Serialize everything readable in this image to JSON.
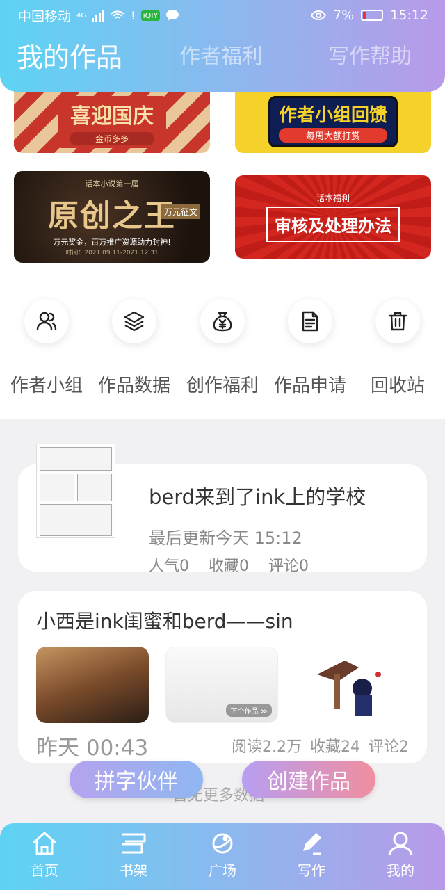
{
  "status_bar": {
    "carrier": "中国移动",
    "network": "4G",
    "battery": "7%",
    "time": "15:12"
  },
  "header": {
    "tabs": [
      {
        "label": "我的作品",
        "active": true
      },
      {
        "label": "作者福利",
        "active": false
      },
      {
        "label": "写作帮助",
        "active": false
      }
    ]
  },
  "banners": [
    {
      "title": "喜迎国庆",
      "subtitle": "金币多多"
    },
    {
      "title": "作者小组回馈",
      "subtitle": "每周大额打赏"
    },
    {
      "top": "话本小说第一届",
      "title": "原创之王",
      "tag": "万元征文",
      "subtitle": "万元奖金，百万推广资源助力封神!",
      "time": "时间：2021.09.11-2021.12.31"
    },
    {
      "top": "话本福利",
      "title": "审核及处理办法"
    }
  ],
  "shortcuts": [
    {
      "label": "作者小组",
      "icon": "users-icon"
    },
    {
      "label": "作品数据",
      "icon": "layers-icon"
    },
    {
      "label": "创作福利",
      "icon": "money-bag-icon"
    },
    {
      "label": "作品申请",
      "icon": "document-icon"
    },
    {
      "label": "回收站",
      "icon": "trash-icon"
    }
  ],
  "works": [
    {
      "title": "berd来到了ink上的学校",
      "updated": "最后更新今天 15:12",
      "popularity": "人气0",
      "favorites": "收藏0",
      "comments": "评论0"
    },
    {
      "title": "小西是ink闺蜜和berd——sin",
      "time": "昨天 00:43",
      "reads": "阅读2.2万",
      "favorites": "收藏24",
      "comments": "评论2",
      "next_label": "下个作品 ≫"
    }
  ],
  "more_text": "暂无更多数据",
  "float_buttons": {
    "partner": "拼字伙伴",
    "create": "创建作品"
  },
  "bottom_nav": [
    {
      "label": "首页",
      "icon": "home-icon"
    },
    {
      "label": "书架",
      "icon": "bookshelf-icon"
    },
    {
      "label": "广场",
      "icon": "planet-icon"
    },
    {
      "label": "写作",
      "icon": "pen-icon",
      "active": true
    },
    {
      "label": "我的",
      "icon": "profile-icon"
    }
  ]
}
